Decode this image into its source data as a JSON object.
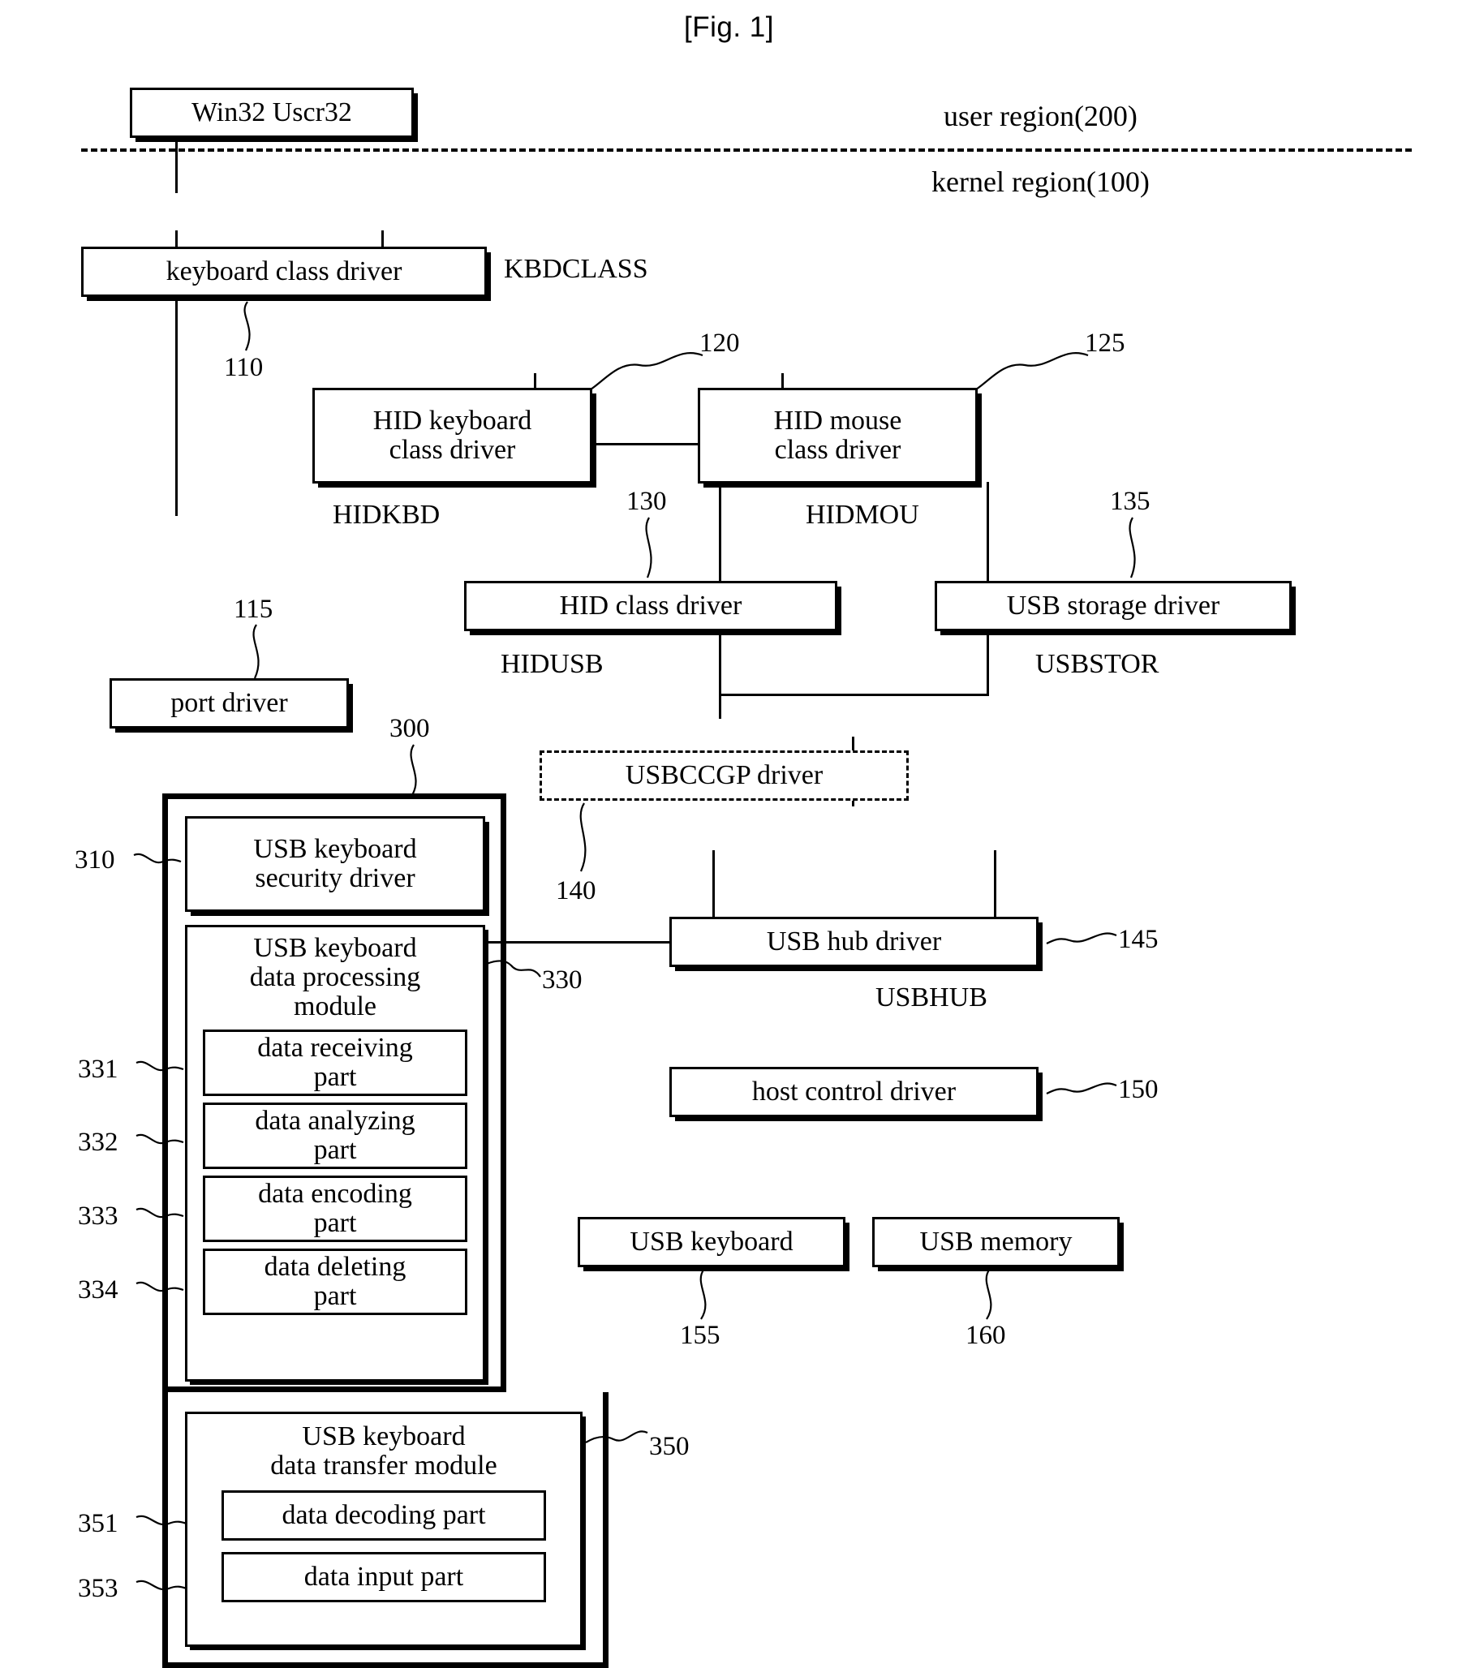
{
  "figure": {
    "title": "[Fig. 1]"
  },
  "regions": {
    "user": "user region(200)",
    "kernel": "kernel region(100)"
  },
  "nodes": {
    "win32": "Win32 Uscr32",
    "keyboard_class_driver": "keyboard class driver",
    "hid_keyboard_class_driver": "HID keyboard\nclass driver",
    "hid_keyboard_class_driver_l1": "HID keyboard",
    "hid_keyboard_class_driver_l2": "class driver",
    "hid_mouse_class_driver_l1": "HID mouse",
    "hid_mouse_class_driver_l2": "class driver",
    "hid_class_driver": "HID class driver",
    "usb_storage_driver": "USB storage driver",
    "port_driver": "port driver",
    "usbccgp_driver": "USBCCGP driver",
    "usb_hub_driver": "USB hub driver",
    "host_control_driver": "host control driver",
    "usb_keyboard": "USB keyboard",
    "usb_memory": "USB memory",
    "usb_keyboard_security_driver_l1": "USB keyboard",
    "usb_keyboard_security_driver_l2": "security driver",
    "usb_keyboard_data_processing_module_l1": "USB keyboard",
    "usb_keyboard_data_processing_module_l2": "data processing",
    "usb_keyboard_data_processing_module_l3": "module",
    "data_receiving_part_l1": "data receiving",
    "data_receiving_part_l2": "part",
    "data_analyzing_part_l1": "data analyzing",
    "data_analyzing_part_l2": "part",
    "data_encoding_part_l1": "data encoding",
    "data_encoding_part_l2": "part",
    "data_deleting_part_l1": "data deleting",
    "data_deleting_part_l2": "part",
    "usb_keyboard_data_transfer_module_l1": "USB keyboard",
    "usb_keyboard_data_transfer_module_l2": "data transfer module",
    "data_decoding_part": "data decoding part",
    "data_input_part": "data input part"
  },
  "driver_names": {
    "kbdclass": "KBDCLASS",
    "hidkbd": "HIDKBD",
    "hidmou": "HIDMOU",
    "hidusb": "HIDUSB",
    "usbstor": "USBSTOR",
    "usbhub": "USBHUB"
  },
  "numerals": {
    "n110": "110",
    "n115": "115",
    "n120": "120",
    "n125": "125",
    "n130": "130",
    "n135": "135",
    "n140": "140",
    "n145": "145",
    "n150": "150",
    "n155": "155",
    "n160": "160",
    "n300": "300",
    "n310": "310",
    "n330": "330",
    "n331": "331",
    "n332": "332",
    "n333": "333",
    "n334": "334",
    "n350": "350",
    "n351": "351",
    "n353": "353"
  },
  "colors": {
    "ink": "#000000",
    "paper": "#ffffff"
  }
}
